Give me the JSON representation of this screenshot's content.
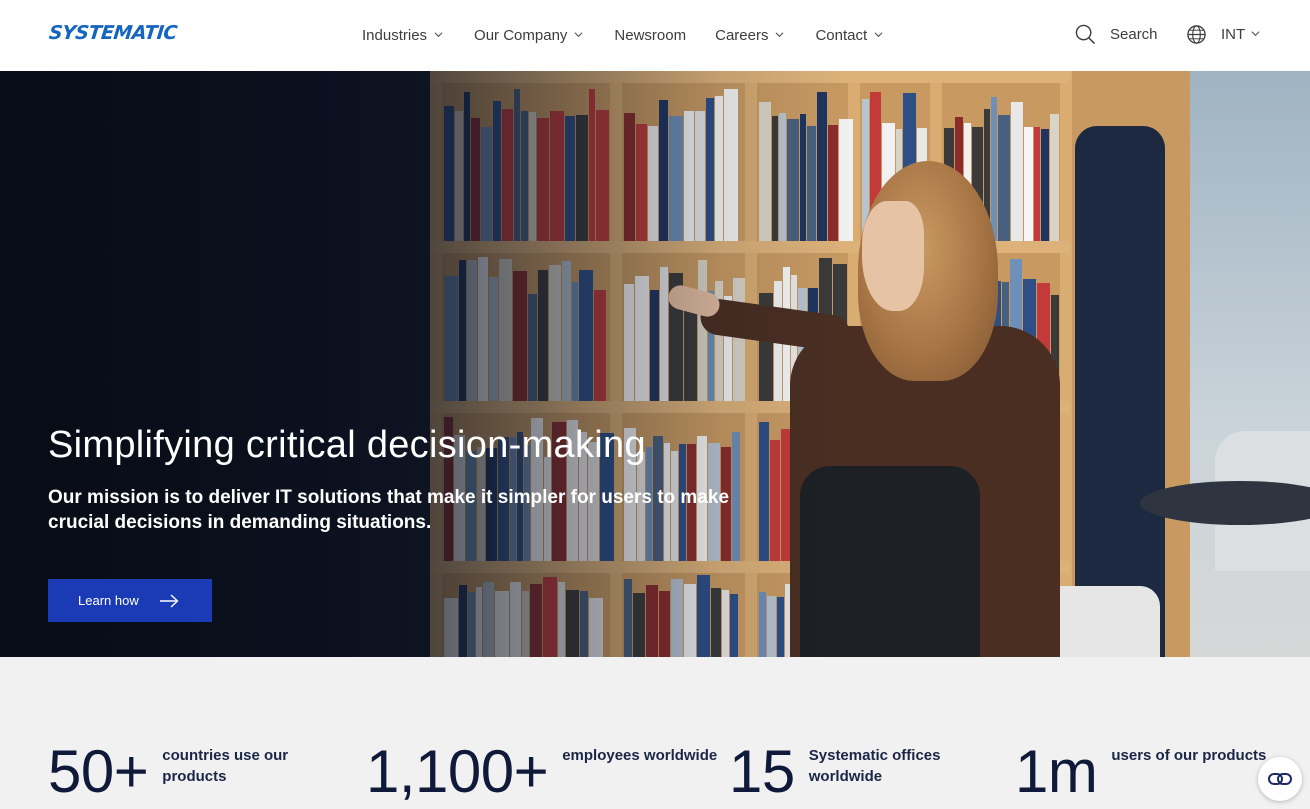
{
  "header": {
    "logo_text": "SYSTEMATIC",
    "nav": [
      {
        "label": "Industries",
        "has_dropdown": true
      },
      {
        "label": "Our Company",
        "has_dropdown": true
      },
      {
        "label": "Newsroom",
        "has_dropdown": false
      },
      {
        "label": "Careers",
        "has_dropdown": true
      },
      {
        "label": "Contact",
        "has_dropdown": true
      }
    ],
    "search_label": "Search",
    "language_label": "INT"
  },
  "hero": {
    "title": "Simplifying critical decision-making",
    "subtitle": "Our mission is to deliver IT solutions that make it simpler for users to make crucial decisions in demanding situations.",
    "cta_label": "Learn how"
  },
  "stats": [
    {
      "number": "50+",
      "label": "countries use our products"
    },
    {
      "number": "1,100+",
      "label": "employees worldwide"
    },
    {
      "number": "15",
      "label": "Systematic offices worldwide"
    },
    {
      "number": "1m",
      "label": "users of our products"
    }
  ],
  "colors": {
    "brand_blue": "#1565c0",
    "cta_blue": "#1a3bb5",
    "stat_text": "#0f1a3a",
    "stats_bg": "#f1f1f1"
  },
  "icons": {
    "search": "search-icon",
    "language": "globe-icon",
    "cta_arrow": "arrow-right-icon",
    "chat": "chat-widget-icon"
  }
}
